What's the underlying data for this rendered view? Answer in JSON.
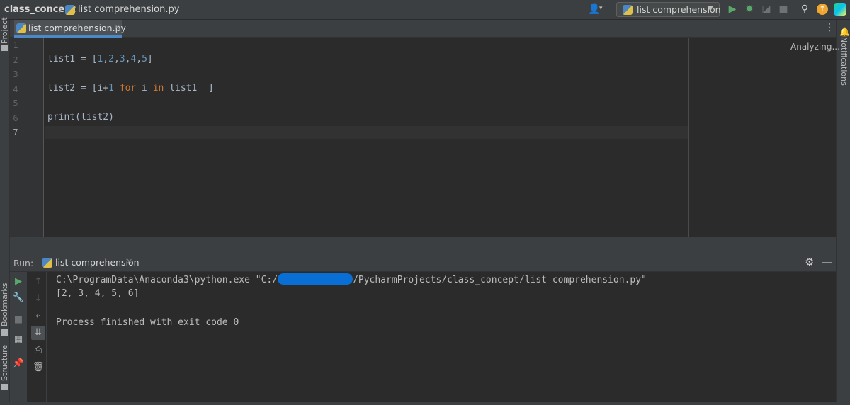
{
  "navbar": {
    "project": "class_concept",
    "file": "list comprehension.py",
    "run_config": "list comprehension"
  },
  "tabs": [
    {
      "label": "list comprehension.py"
    }
  ],
  "editor": {
    "status": "Analyzing...",
    "line_numbers": [
      "1",
      "2",
      "3",
      "4",
      "5",
      "6",
      "7"
    ]
  },
  "left_strip": {
    "project": "Project",
    "bookmarks": "Bookmarks",
    "structure": "Structure"
  },
  "right_strip": {
    "notifications": "Notifications"
  },
  "run": {
    "label": "Run:",
    "tab_label": "list comprehension",
    "console": {
      "command_prefix": "C:\\ProgramData\\Anaconda3\\python.exe \"C:/",
      "command_suffix": "/PycharmProjects/class_concept/list comprehension.py\"",
      "output": "[2, 3, 4, 5, 6]",
      "finished": "Process finished with exit code 0"
    }
  },
  "colors": {
    "redaction": "#0a6fd4",
    "run_green": "#59a869",
    "update_orange": "#f0a732"
  },
  "icons": [
    "user-icon",
    "python-file-icon",
    "run-icon",
    "debug-icon",
    "coverage-icon",
    "stop-icon",
    "search-icon",
    "update-icon",
    "jetbrains-logo-icon",
    "more-icon",
    "gear-icon",
    "minimize-icon",
    "rerun-icon",
    "wrench-icon",
    "arrow-up-icon",
    "arrow-down-icon",
    "soft-wrap-icon",
    "scroll-end-icon",
    "print-icon",
    "trash-icon",
    "pin-icon",
    "layout-icon",
    "stop-square-icon",
    "bell-icon"
  ]
}
